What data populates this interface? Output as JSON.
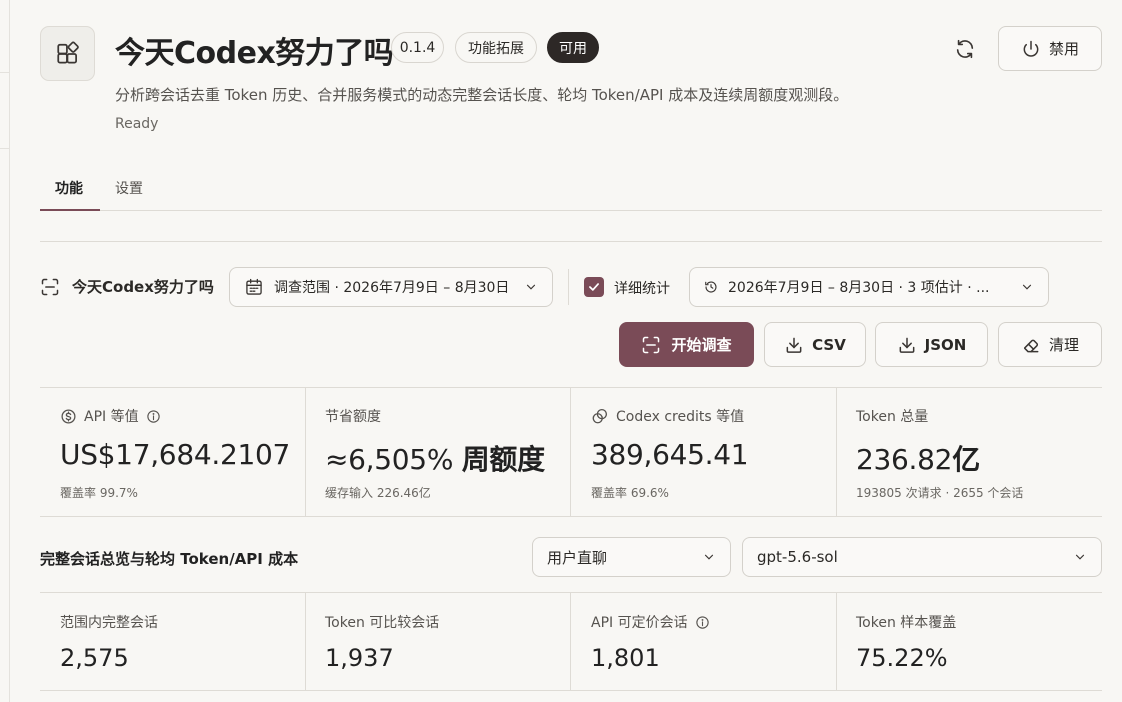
{
  "header": {
    "title": "今天Codex努力了吗",
    "version": "0.1.4",
    "tag": "功能拓展",
    "availability": "可用",
    "description": "分析跨会话去重 Token 历史、合并服务模式的动态完整会话长度、轮均 Token/API 成本及连续周额度观测段。",
    "status": "Ready",
    "disable_label": "禁用"
  },
  "tabs": [
    {
      "label": "功能",
      "active": true
    },
    {
      "label": "设置",
      "active": false
    }
  ],
  "toolbar": {
    "scan_label": "今天Codex努力了吗",
    "range_select": "调查范围 · 2026年7月9日 – 8月30日",
    "detail_checkbox": {
      "label": "详细统计",
      "checked": true
    },
    "stats_select": "2026年7月9日 – 8月30日 · 3 项估计 · ...",
    "start_label": "开始调查",
    "csv_label": "CSV",
    "json_label": "JSON",
    "clear_label": "清理"
  },
  "metrics": [
    {
      "label": "API 等值",
      "value": "US$17,684.2107",
      "sub": "覆盖率 99.7%",
      "icon": "dollar-icon",
      "info": true
    },
    {
      "label": "节省额度",
      "value_prefix": "≈6,505%",
      "value_suffix": "周额度",
      "sub": "缓存输入 226.46亿"
    },
    {
      "label": "Codex credits 等值",
      "value": "389,645.41",
      "sub": "覆盖率 69.6%",
      "icon": "coins-icon"
    },
    {
      "label": "Token 总量",
      "value_number": "236.82",
      "value_unit": "亿",
      "sub": "193805 次请求 · 2655 个会话"
    }
  ],
  "overview": {
    "title": "完整会话总览与轮均 Token/API 成本",
    "mode_select": "用户直聊",
    "model_select": "gpt-5.6-sol",
    "stats": [
      {
        "label": "范围内完整会话",
        "value": "2,575"
      },
      {
        "label": "Token 可比较会话",
        "value": "1,937"
      },
      {
        "label": "API 可定价会话",
        "value": "1,801",
        "info": true
      },
      {
        "label": "Token 样本覆盖",
        "value": "75.22%"
      }
    ]
  },
  "colors": {
    "accent": "#7a4b57",
    "background": "#f8f7f4",
    "dark_pill": "#2d2826",
    "border": "#dedbd5"
  }
}
